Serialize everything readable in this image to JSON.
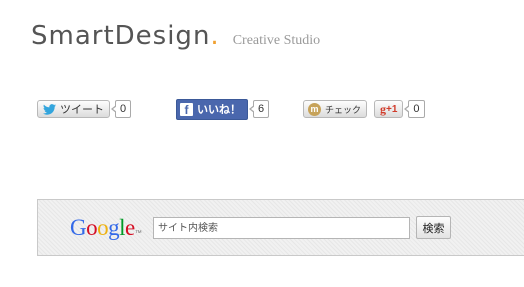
{
  "header": {
    "brand_name": "SmartDesign",
    "brand_dot": ".",
    "tagline": "Creative Studio",
    "accent_color": "#f0a030"
  },
  "social": {
    "twitter": {
      "label": "ツイート",
      "count": "0",
      "icon": "twitter-bird-icon"
    },
    "facebook": {
      "label": "いいね！",
      "count": "6",
      "icon": "facebook-f-icon",
      "color": "#4a67ad"
    },
    "mixi": {
      "label": "チェック",
      "icon": "mixi-icon"
    },
    "google_plus": {
      "g": "g",
      "plus": "+1",
      "count": "0"
    }
  },
  "search": {
    "logo_letters": [
      "G",
      "o",
      "o",
      "g",
      "l",
      "e"
    ],
    "logo_colors": [
      "#3369e8",
      "#d50f25",
      "#eeb211",
      "#3369e8",
      "#009925",
      "#d50f25"
    ],
    "logo_tm": "™",
    "placeholder": "サイト内検索",
    "value": "",
    "button_label": "検索"
  }
}
